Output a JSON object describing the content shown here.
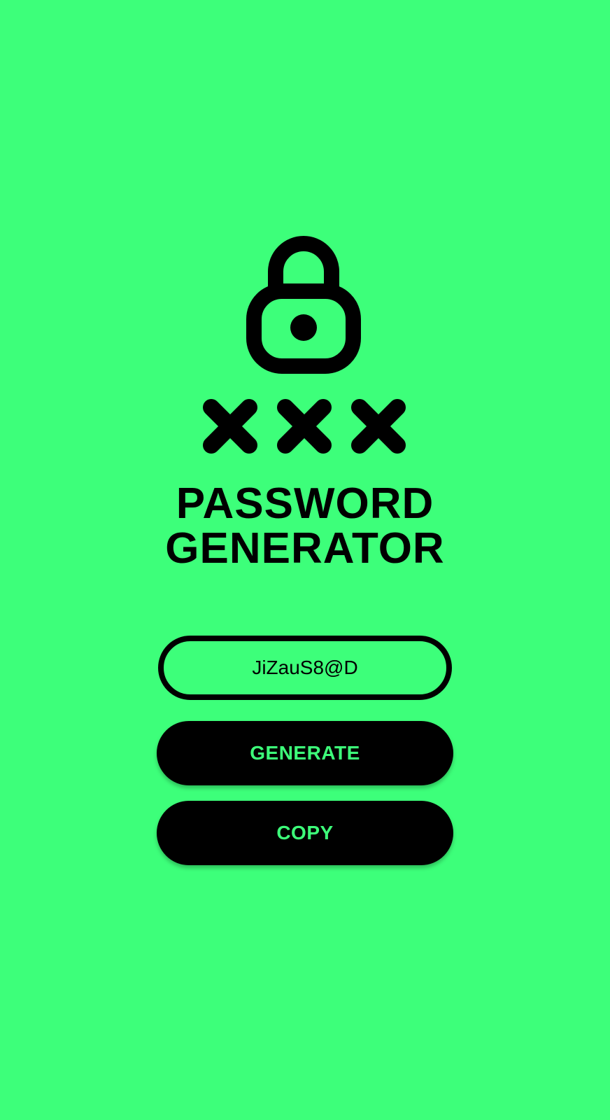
{
  "app": {
    "title_line1": "PASSWORD",
    "title_line2": "GENERATOR"
  },
  "password": {
    "value": "JiZauS8@D"
  },
  "buttons": {
    "generate_label": "GENERATE",
    "copy_label": "COPY"
  },
  "icons": {
    "lock": "lock-icon",
    "masked": "masked-characters-icon"
  },
  "colors": {
    "background": "#3dff7a",
    "foreground": "#000000",
    "button_text": "#3dff7a"
  }
}
